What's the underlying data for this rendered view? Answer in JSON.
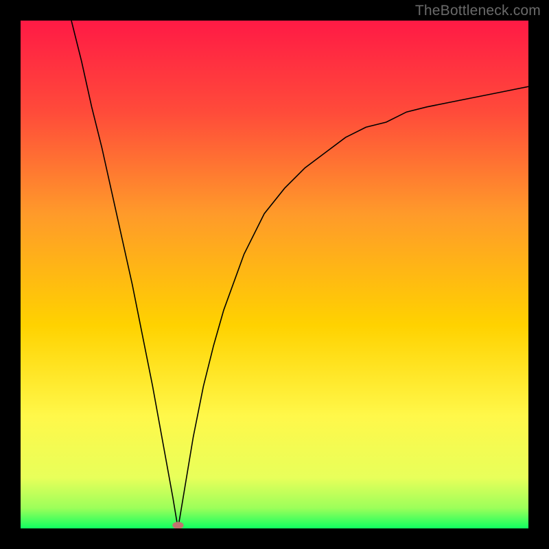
{
  "watermark": "TheBottleneck.com",
  "chart_data": {
    "type": "line",
    "title": "",
    "xlabel": "",
    "ylabel": "",
    "xlim": [
      0,
      100
    ],
    "ylim": [
      0,
      100
    ],
    "background_gradient": {
      "top": "#ff1a45",
      "mid": "#ffd200",
      "bottom": "#10ff60"
    },
    "marker": {
      "x": 31,
      "y": 0,
      "fill": "#c0736f"
    },
    "series": [
      {
        "name": "curve",
        "stroke": "#000000",
        "points": [
          {
            "x": 10,
            "y": 100
          },
          {
            "x": 12,
            "y": 92
          },
          {
            "x": 14,
            "y": 83
          },
          {
            "x": 16,
            "y": 75
          },
          {
            "x": 18,
            "y": 66
          },
          {
            "x": 20,
            "y": 57
          },
          {
            "x": 22,
            "y": 48
          },
          {
            "x": 24,
            "y": 38
          },
          {
            "x": 26,
            "y": 28
          },
          {
            "x": 28,
            "y": 17
          },
          {
            "x": 30,
            "y": 6
          },
          {
            "x": 31,
            "y": 0
          },
          {
            "x": 32,
            "y": 6
          },
          {
            "x": 34,
            "y": 18
          },
          {
            "x": 36,
            "y": 28
          },
          {
            "x": 38,
            "y": 36
          },
          {
            "x": 40,
            "y": 43
          },
          {
            "x": 44,
            "y": 54
          },
          {
            "x": 48,
            "y": 62
          },
          {
            "x": 52,
            "y": 67
          },
          {
            "x": 56,
            "y": 71
          },
          {
            "x": 60,
            "y": 74
          },
          {
            "x": 64,
            "y": 77
          },
          {
            "x": 68,
            "y": 79
          },
          {
            "x": 72,
            "y": 80
          },
          {
            "x": 76,
            "y": 82
          },
          {
            "x": 80,
            "y": 83
          },
          {
            "x": 85,
            "y": 84
          },
          {
            "x": 90,
            "y": 85
          },
          {
            "x": 95,
            "y": 86
          },
          {
            "x": 100,
            "y": 87
          }
        ]
      }
    ]
  }
}
